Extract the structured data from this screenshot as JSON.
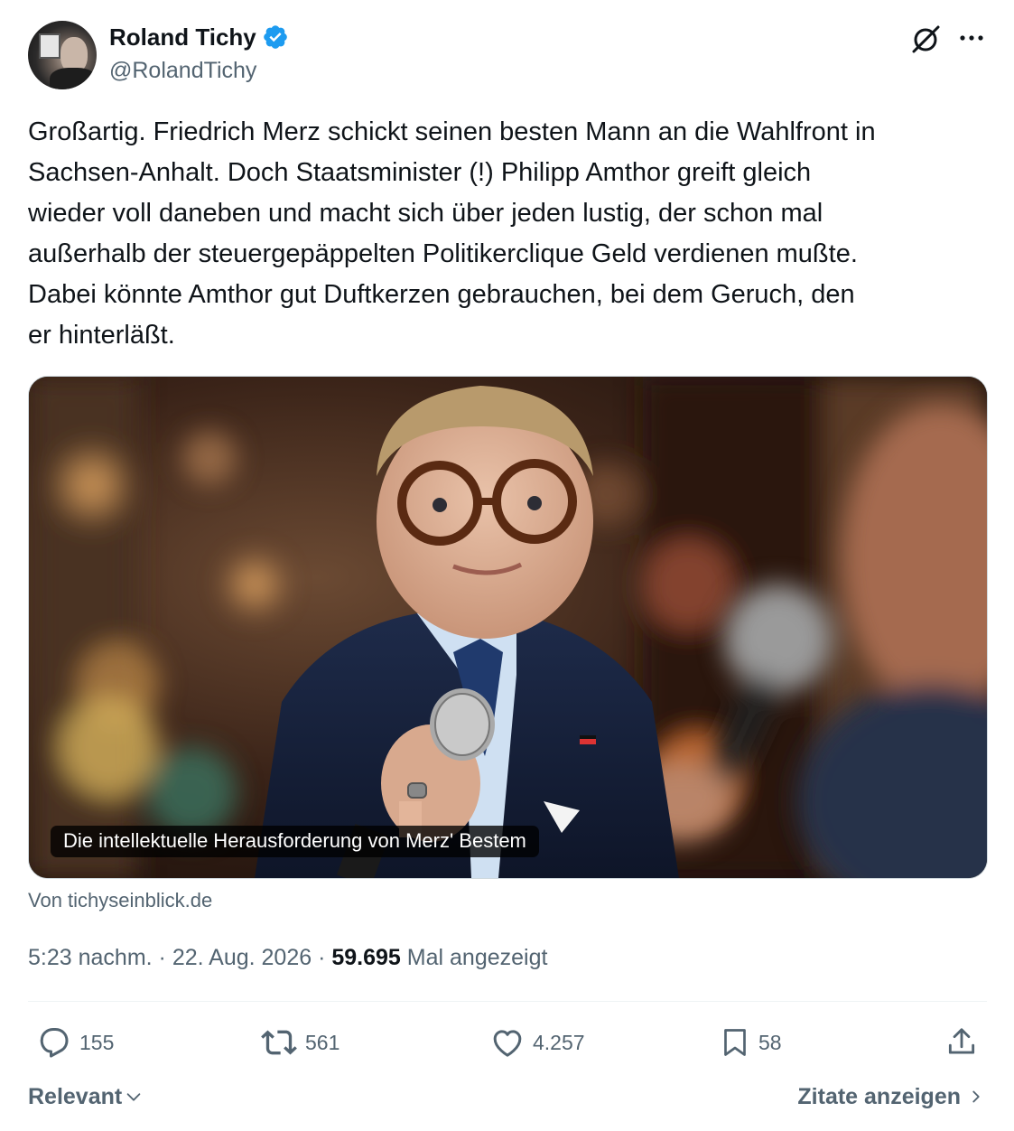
{
  "author": {
    "display_name": "Roland Tichy",
    "handle": "@RolandTichy",
    "verified": true
  },
  "icons": {
    "verified": "verified-badge-icon",
    "grok": "grok-icon",
    "more": "more-icon",
    "reply": "reply-icon",
    "repost": "repost-icon",
    "like": "like-icon",
    "bookmark": "bookmark-icon",
    "share": "share-icon",
    "chevron_down": "chevron-down-icon",
    "chevron_right": "chevron-right-icon"
  },
  "tweet": {
    "text": "Großartig. Friedrich Merz schickt seinen besten Mann an die Wahlfront in\nSachsen-Anhalt. Doch Staatsminister (!) Philipp Amthor greift gleich\nwieder voll daneben und macht sich über jeden lustig, der schon mal\naußerhalb der steuergepäppelten Politikerclique Geld verdienen mußte.\nDabei könnte Amthor gut Duftkerzen gebrauchen, bei dem Geruch, den\ner hinterläßt."
  },
  "link_card": {
    "caption": "Die intellektuelle Herausforderung von Merz' Bestem",
    "source": "Von tichyseinblick.de"
  },
  "meta": {
    "time": "5:23 nachm.",
    "separator": "·",
    "date": "22. Aug. 2026",
    "views_count": "59.695",
    "views_label": "Mal angezeigt"
  },
  "actions": {
    "replies": "155",
    "reposts": "561",
    "likes": "4.257",
    "bookmarks": "58"
  },
  "footer": {
    "sort_label": "Relevant",
    "quotes_label": "Zitate anzeigen"
  },
  "colors": {
    "text_primary": "#0f1419",
    "text_secondary": "#536471",
    "verified_blue": "#1d9bf0",
    "divider": "#eff3f4"
  }
}
